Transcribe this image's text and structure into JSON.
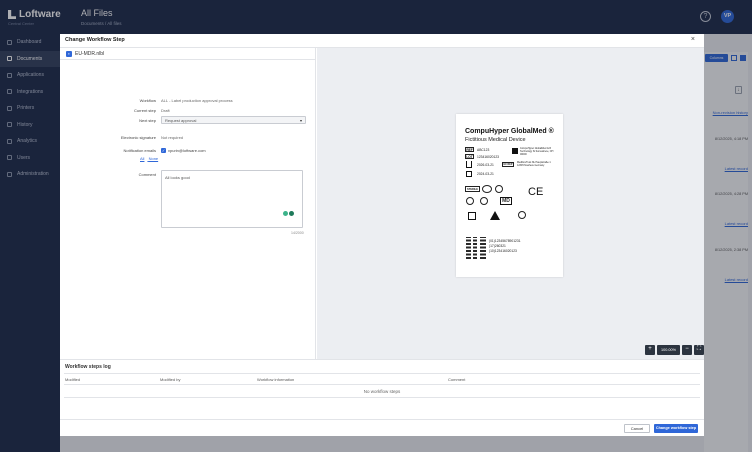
{
  "app": {
    "logo_text": "Loftware",
    "logo_sub": "Central Center",
    "page_title": "All Files",
    "breadcrumb": "Documents / All files",
    "avatar_initials": "VP",
    "help_icon": "question-circle-icon"
  },
  "sidebar": {
    "items": [
      {
        "label": "Dashboard",
        "icon": "home-icon",
        "active": false
      },
      {
        "label": "Documents",
        "icon": "folder-icon",
        "active": true
      },
      {
        "label": "Applications",
        "icon": "apps-icon",
        "active": false
      },
      {
        "label": "Integrations",
        "icon": "braces-icon",
        "active": false
      },
      {
        "label": "Printers",
        "icon": "printer-icon",
        "active": false
      },
      {
        "label": "History",
        "icon": "history-icon",
        "active": false
      },
      {
        "label": "Analytics",
        "icon": "chart-icon",
        "active": false
      },
      {
        "label": "Users",
        "icon": "users-icon",
        "active": false
      },
      {
        "label": "Administration",
        "icon": "gear-icon",
        "active": false
      }
    ]
  },
  "background": {
    "toggle_label": "Columns",
    "first_link": "Non-revision history",
    "dates": [
      "8/12/2025, 4:18 PM",
      "8/12/2025, 4:28 PM",
      "8/12/2025, 2:38 PM"
    ],
    "record_link": "Latest record"
  },
  "modal": {
    "title": "Change Workflow Step",
    "close_icon": "close-icon",
    "file_name": "EU-MDR.nlbl",
    "form": {
      "workflow_label": "Workflow",
      "workflow_value": "ALL - Label production approval process",
      "current_step_label": "Current step",
      "current_step_value": "Draft",
      "next_step_label": "Next step",
      "next_step_value": "Request approval",
      "esig_label": "Electronic signature",
      "esig_value": "Not required",
      "notif_label": "Notification emails",
      "notif_chip": "vpurin@loftware.com",
      "link_all": "All",
      "link_none": "None",
      "comment_label": "Comment",
      "comment_value": "All looks good",
      "char_count": "14/2000"
    },
    "preview": {
      "doc_title": "CompuHyper GlobalMed ®",
      "doc_subtitle": "Fictitious Medical Device",
      "ref_label": "REF",
      "ref_value": "ABC123",
      "lot_label": "LOT",
      "lot_value": "123416020123",
      "manufacturer": "CompuHyper GlobalMed 123 Technology St Somewhere, OH 00000",
      "expiry_date": "2026-03-21",
      "mfg_date": "2024-03-21",
      "ec_rep_label": "EC REP",
      "ec_rep": "MedDevTrust NL Hauptstraße 1 12345 Nowhere Germany",
      "sterile": "STERILE",
      "udi": [
        "(01)12345678901231",
        "(17)260321",
        "(10)123416020123"
      ],
      "md_label": "MD",
      "ce_label": "CE",
      "zoom_value": "100.00%"
    },
    "log": {
      "title": "Workflow steps log",
      "columns": [
        "Modified",
        "Modified by",
        "Workflow information",
        "Comment"
      ],
      "empty_text": "No workflow steps"
    },
    "footer": {
      "cancel_label": "Cancel",
      "submit_label": "Change workflow step"
    }
  },
  "colors": {
    "brand_navy": "#1e2b4a",
    "accent_blue": "#2f67d8"
  }
}
